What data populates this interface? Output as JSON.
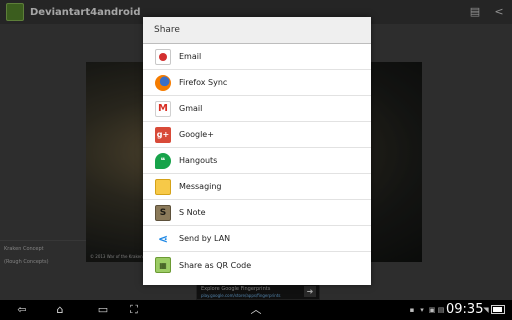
{
  "app": {
    "title": "Deviantart4android",
    "side_text": [
      "Kraken Concept",
      "(Rough Concepts)"
    ],
    "art_caption": "© 2013 War of the Kraken Mt",
    "ad": {
      "line1": "Explore Google Fingerprints",
      "line2": "play.google.com/store/apps/fingerprints"
    }
  },
  "dialog": {
    "title": "Share",
    "items": [
      {
        "label": "Email",
        "icon": "email-icon"
      },
      {
        "label": "Firefox Sync",
        "icon": "firefox-icon"
      },
      {
        "label": "Gmail",
        "icon": "gmail-icon"
      },
      {
        "label": "Google+",
        "icon": "google-plus-icon"
      },
      {
        "label": "Hangouts",
        "icon": "hangouts-icon"
      },
      {
        "label": "Messaging",
        "icon": "messaging-icon"
      },
      {
        "label": "S Note",
        "icon": "s-note-icon"
      },
      {
        "label": "Send by LAN",
        "icon": "share-lan-icon"
      },
      {
        "label": "Share as QR Code",
        "icon": "qr-code-icon"
      }
    ]
  },
  "status_bar": {
    "time": "09:35",
    "battery_level": 0.9
  },
  "colors": {
    "dialog_header_bg": "#efefef",
    "action_bar_bg": "#3a3a3a",
    "system_bar_bg": "#000000"
  }
}
